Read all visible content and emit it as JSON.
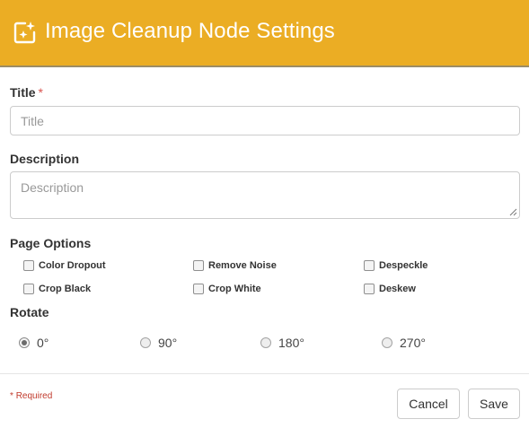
{
  "header": {
    "title": "Image Cleanup Node Settings",
    "icon": "sparkle-image-icon"
  },
  "form": {
    "title_label": "Title",
    "required_mark": "*",
    "title_placeholder": "Title",
    "title_value": "",
    "description_label": "Description",
    "description_placeholder": "Description",
    "description_value": "",
    "page_options_label": "Page Options",
    "page_options": [
      {
        "label": "Color Dropout",
        "checked": false
      },
      {
        "label": "Remove Noise",
        "checked": false
      },
      {
        "label": "Despeckle",
        "checked": false
      },
      {
        "label": "Crop Black",
        "checked": false
      },
      {
        "label": "Crop White",
        "checked": false
      },
      {
        "label": "Deskew",
        "checked": false
      }
    ],
    "rotate_label": "Rotate",
    "rotate_options": [
      {
        "label": "0°",
        "checked": true
      },
      {
        "label": "90°",
        "checked": false
      },
      {
        "label": "180°",
        "checked": false
      },
      {
        "label": "270°",
        "checked": false
      }
    ]
  },
  "footer": {
    "required_mark": "*",
    "required_note": "Required",
    "cancel_label": "Cancel",
    "save_label": "Save"
  },
  "colors": {
    "header_bg": "#ebad24",
    "required": "#d9534f"
  }
}
